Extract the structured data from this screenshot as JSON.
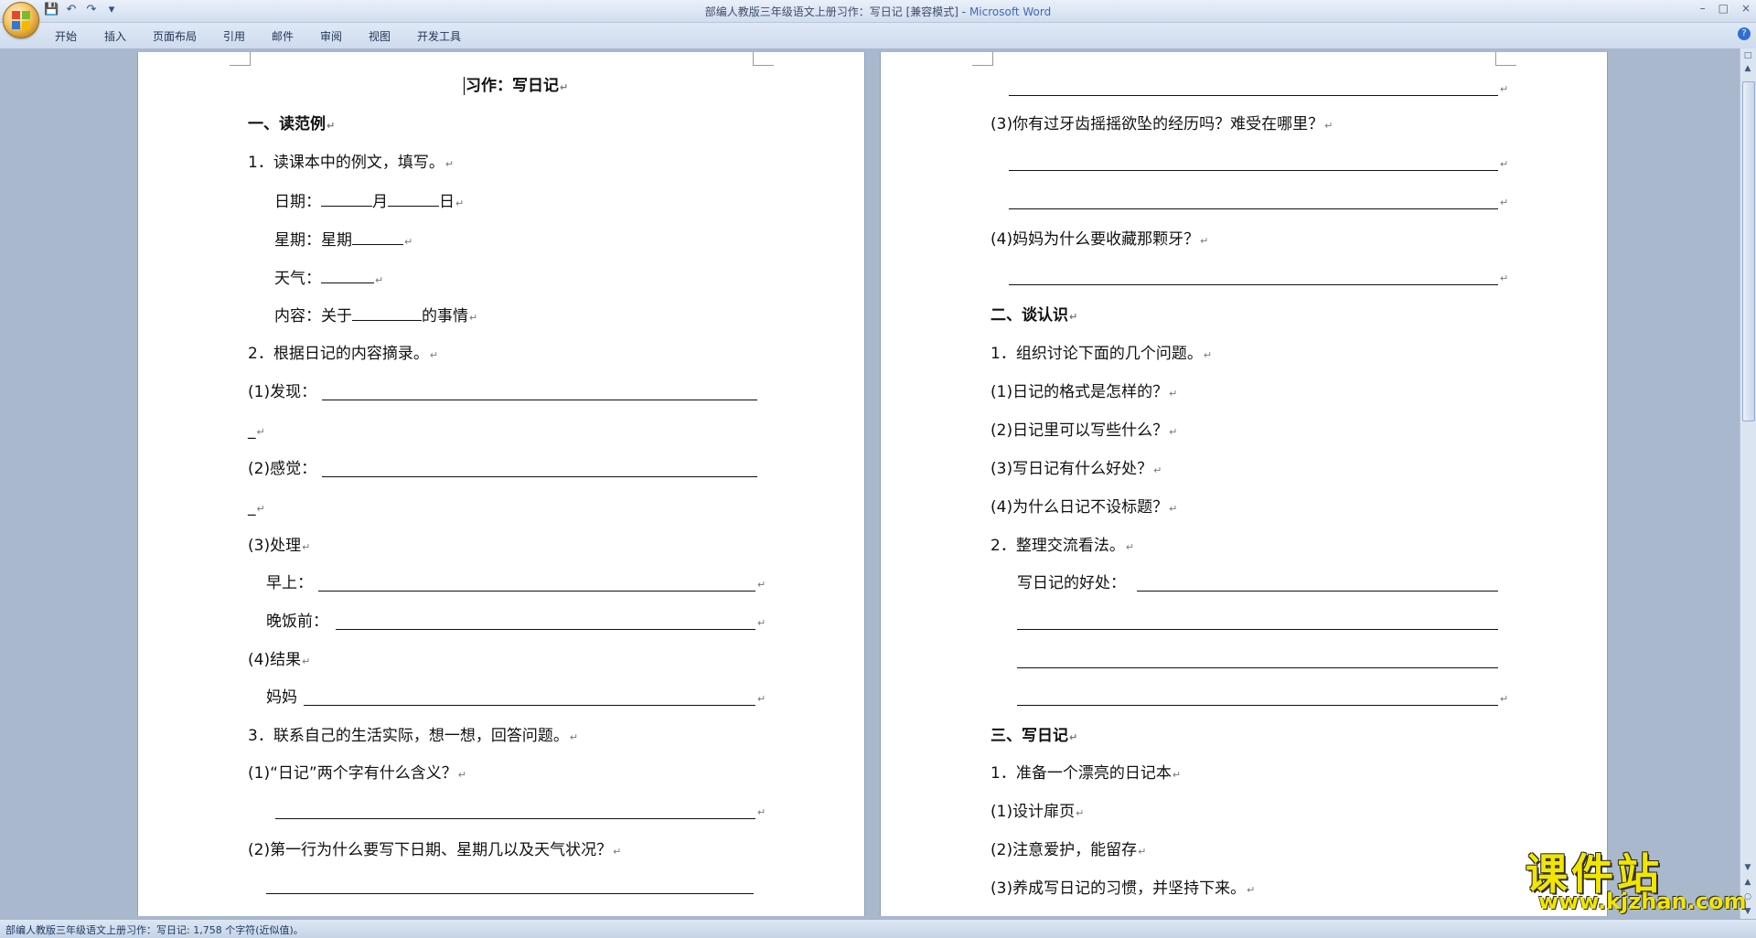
{
  "window": {
    "title": "部编人教版三年级语文上册习作：写日记 [兼容模式]",
    "app_name": "Microsoft Word",
    "controls": [
      "–",
      "□",
      "×"
    ]
  },
  "ribbon": {
    "tabs": [
      "开始",
      "插入",
      "页面布局",
      "引用",
      "邮件",
      "审阅",
      "视图",
      "开发工具"
    ]
  },
  "quick_access": [
    "save-icon",
    "undo-icon",
    "redo-icon",
    "customize-icon"
  ],
  "page1": {
    "title": "习作：写日记",
    "s1": "一、读范例",
    "i1": "1．读课本中的例文，填写。",
    "date_a": "日期：",
    "date_b": "月",
    "date_c": "日",
    "week": "星期：星期",
    "weather": "天气：",
    "content_a": "内容：关于",
    "content_b": "的事情",
    "i2": "2．根据日记的内容摘录。",
    "f1": "(1)发现：",
    "f1_cont": "_",
    "f2": "(2)感觉：",
    "f2_cont": "_",
    "f3": "(3)处理",
    "morning": "早上：",
    "evening": "晚饭前：",
    "f4": "(4)结果",
    "mom": "妈妈",
    "i3": "3．联系自己的生活实际，想一想，回答问题。",
    "q1": "(1)“日记”两个字有什么含义？",
    "q2": "(2)第一行为什么要写下日期、星期几以及天气状况？"
  },
  "page2": {
    "q3": "(3)你有过牙齿摇摇欲坠的经历吗？难受在哪里？",
    "q4": "(4)妈妈为什么要收藏那颗牙？",
    "s2": "二、谈认识",
    "d1": "1．组织讨论下面的几个问题。",
    "d1a": "(1)日记的格式是怎样的？",
    "d1b": "(2)日记里可以写些什么？",
    "d1c": "(3)写日记有什么好处？",
    "d1d": "(4)为什么日记不设标题？",
    "d2": "2．整理交流看法。",
    "benefit": "写日记的好处：",
    "s3": "三、写日记",
    "w1": "1．准备一个漂亮的日记本",
    "w1a": "(1)设计扉页",
    "w1b": "(2)注意爱护，能留存",
    "w1c": "(3)养成写日记的习惯，并坚持下来。"
  },
  "status": {
    "text": "部编人教版三年级语文上册习作：写日记: 1,758 个字符(近似值)。"
  },
  "watermark": {
    "title": "课件站",
    "url": "www.kjzhan.com"
  },
  "return_mark": "↵"
}
